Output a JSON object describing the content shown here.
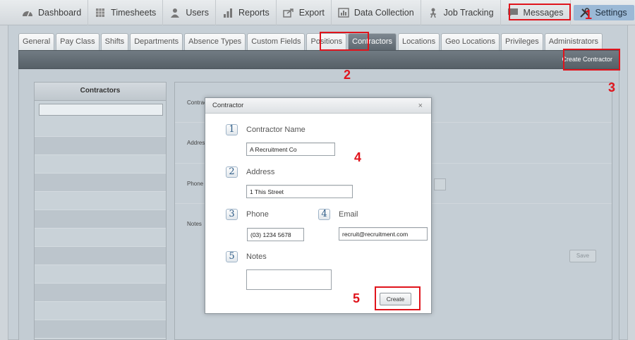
{
  "nav": {
    "items": [
      {
        "label": "Dashboard",
        "icon": "dashboard-icon"
      },
      {
        "label": "Timesheets",
        "icon": "timesheets-icon"
      },
      {
        "label": "Users",
        "icon": "users-icon"
      },
      {
        "label": "Reports",
        "icon": "reports-icon"
      },
      {
        "label": "Export",
        "icon": "export-icon"
      },
      {
        "label": "Data Collection",
        "icon": "data-collection-icon"
      },
      {
        "label": "Job Tracking",
        "icon": "job-tracking-icon"
      },
      {
        "label": "Messages",
        "icon": "messages-icon"
      },
      {
        "label": "Settings",
        "icon": "settings-icon"
      }
    ]
  },
  "subtabs": [
    "General",
    "Pay Class",
    "Shifts",
    "Departments",
    "Absence Types",
    "Custom Fields",
    "Positions",
    "Contractors",
    "Locations",
    "Geo Locations",
    "Privileges",
    "Administrators"
  ],
  "toolbar": {
    "create_contractor": "Create Contractor"
  },
  "left_panel": {
    "title": "Contractors"
  },
  "right_panel": {
    "contractor_label": "Contrac",
    "address_label": "Addres",
    "phone_label": "Phone",
    "notes_label": "Notes",
    "save_label": "Save"
  },
  "dialog": {
    "title": "Contractor",
    "close": "×",
    "fields": {
      "name": {
        "num": "1",
        "label": "Contractor Name",
        "value": "A Recruitment Co"
      },
      "address": {
        "num": "2",
        "label": "Address",
        "value": "1 This Street"
      },
      "phone": {
        "num": "3",
        "label": "Phone",
        "value": "(03) 1234 5678"
      },
      "email": {
        "num": "4",
        "label": "Email",
        "value": "recruit@recruitment.com"
      },
      "notes": {
        "num": "5",
        "label": "Notes",
        "value": ""
      }
    },
    "create_label": "Create"
  },
  "annotations": [
    "1",
    "2",
    "3",
    "4",
    "5"
  ],
  "colors": {
    "annotation": "#e0141c",
    "active_nav": "#9bb9d6",
    "active_tab": "#5e6870"
  }
}
